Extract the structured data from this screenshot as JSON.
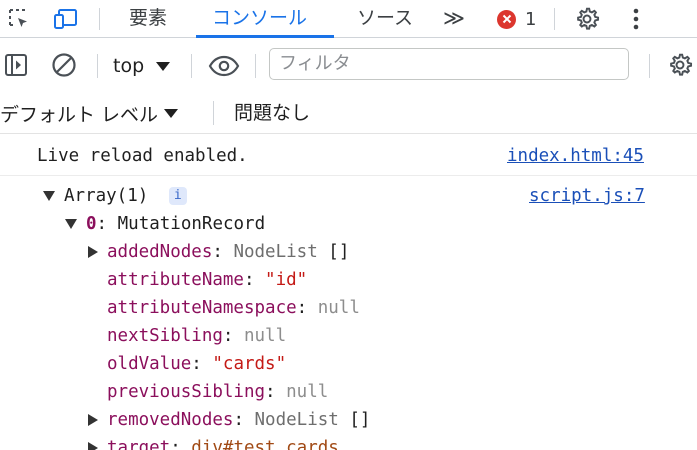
{
  "tabs": {
    "elements_label": "要素",
    "console_label": "コンソール",
    "sources_label": "ソース",
    "more_label": "≫"
  },
  "errors": {
    "count": "1"
  },
  "toolbar": {
    "context_label": "top",
    "filter_placeholder": "フィルタ"
  },
  "levelbar": {
    "level_label": "デフォルト レベル",
    "issues_label": "問題なし"
  },
  "messages": {
    "live_reload": {
      "text": "Live reload enabled.",
      "source": "index.html:45"
    },
    "array_log": {
      "summary": "Array(1)",
      "info_badge": "i",
      "source": "script.js:7",
      "record": {
        "index": "0",
        "type_name": "MutationRecord",
        "props": {
          "addedNodes_key": "addedNodes",
          "addedNodes_val": "NodeList",
          "addedNodes_brackets": "[]",
          "attributeName_key": "attributeName",
          "attributeName_val": "\"id\"",
          "attributeNamespace_key": "attributeNamespace",
          "attributeNamespace_val": "null",
          "nextSibling_key": "nextSibling",
          "nextSibling_val": "null",
          "oldValue_key": "oldValue",
          "oldValue_val": "\"cards\"",
          "previousSibling_key": "previousSibling",
          "previousSibling_val": "null",
          "removedNodes_key": "removedNodes",
          "removedNodes_val": "NodeList",
          "removedNodes_brackets": "[]",
          "target_key": "target",
          "target_val": "div#test.cards"
        }
      }
    }
  },
  "colors": {
    "accent": "#1a73e8",
    "error": "#dc362e",
    "property_key": "#8b0f5c",
    "string_value": "#c41a16",
    "link": "#1a4fb8"
  }
}
